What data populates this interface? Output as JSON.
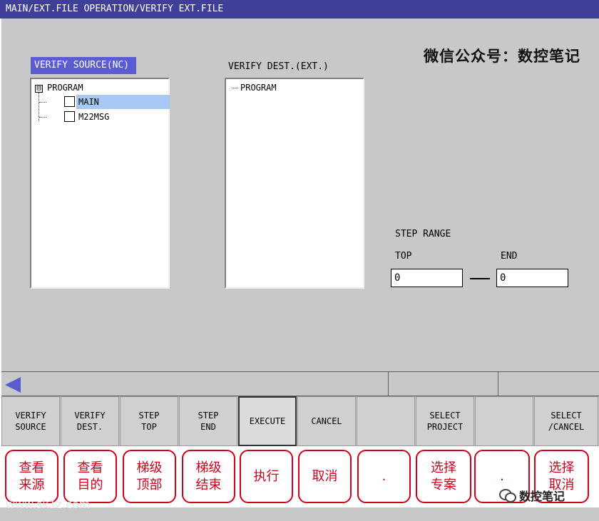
{
  "window": {
    "title": "MAIN/EXT.FILE OPERATION/VERIFY EXT.FILE"
  },
  "watermark": "微信公众号：数控笔记",
  "source": {
    "label": "VERIFY SOURCE(NC)",
    "tree": {
      "root": "PROGRAM",
      "expander": "⊟",
      "items": [
        {
          "label": "MAIN",
          "selected": true
        },
        {
          "label": "M22MSG",
          "selected": false
        }
      ]
    }
  },
  "dest": {
    "label": "VERIFY DEST.(EXT.)",
    "tree": {
      "root": "PROGRAM"
    }
  },
  "step_range": {
    "title": "STEP RANGE",
    "top_label": "TOP",
    "end_label": "END",
    "top_value": "0",
    "end_value": "0"
  },
  "softkeys": [
    {
      "label": "VERIFY\nSOURCE",
      "annotation": "查看\n来源"
    },
    {
      "label": "VERIFY\nDEST.",
      "annotation": "查看\n目的"
    },
    {
      "label": "STEP\nTOP",
      "annotation": "梯级\n顶部"
    },
    {
      "label": "STEP\nEND",
      "annotation": "梯级\n结束"
    },
    {
      "label": "EXECUTE",
      "annotation": "执行"
    },
    {
      "label": "CANCEL",
      "annotation": "取消"
    },
    {
      "label": "",
      "annotation": "."
    },
    {
      "label": "SELECT\nPROJECT",
      "annotation": "选择\n专案"
    },
    {
      "label": "",
      "annotation": "."
    },
    {
      "label": "SELECT\n/CANCEL",
      "annotation": "选择\n取消"
    }
  ],
  "footer": {
    "left_watermark": "www.sk1z.com",
    "right_brand": "数控笔记"
  },
  "colors": {
    "title_bar": "#3f3f98",
    "label_bg": "#5b5bd2",
    "selection": "#a6c8f2",
    "annotation": "#d0021b"
  }
}
